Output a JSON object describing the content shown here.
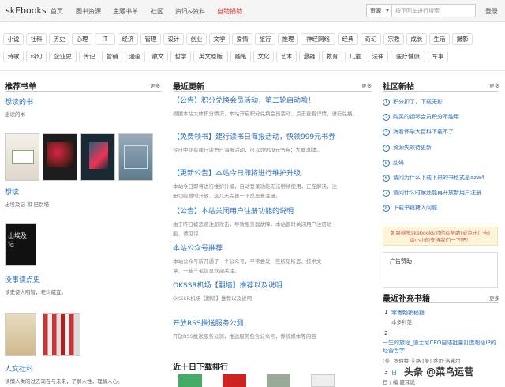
{
  "header": {
    "logo": "skEbooks",
    "nav": [
      "首页",
      "图书资源",
      "主题书单",
      "社区",
      "资讯&资料",
      "自助捐助"
    ],
    "search_scope": "资源",
    "search_placeholder": "按下回车进行搜索",
    "login": "登录"
  },
  "tags": [
    "小说",
    "社科",
    "历史",
    "心理",
    "IT",
    "经济",
    "管理",
    "设计",
    "创业",
    "文学",
    "爱情",
    "旅行",
    "推理",
    "神经网络",
    "经典",
    "奇幻",
    "宗教",
    "成长",
    "生活",
    "摄影",
    "诗歌",
    "科幻",
    "企业史",
    "传记",
    "营销",
    "漫画",
    "散文",
    "哲学",
    "英文原版",
    "随笔",
    "文化",
    "艺术",
    "悬疑",
    "教育",
    "儿童",
    "法律",
    "医疗健康",
    "军事"
  ],
  "left": {
    "heading": "推荐书单",
    "more": "更多",
    "lists": [
      {
        "title": "想读的书",
        "desc": "想读的书"
      },
      {
        "title": "想读",
        "desc": "出埃及记 和 巴别塔"
      },
      {
        "title": "没事读点史",
        "desc": "读史使人明智，老少咸宜。"
      },
      {
        "title": "人文社科",
        "desc": "读懂人类的过去现在与未来，了解人性，理解人心。"
      }
    ],
    "cover_text": "出埃及记"
  },
  "middle": {
    "heading": "最近更新",
    "more": "更多",
    "news": [
      {
        "title": "【公告】积分兑换会员活动，第二轮启动啦！",
        "desc": [
          "根据本站大体积分情况，本站开启积分兑换会员活动，点击查看详情，进行兑换。"
        ]
      },
      {
        "title": "【免费领书】建行读书日海报活动，快领999元书券",
        "desc": [
          "今日中亚有建行读书日海报活动，可以领999元书券；大概30本。"
        ]
      },
      {
        "title": "【更新公告】本站今日即将进行维护升级",
        "desc": [
          "本站今日即将进行维护升级，自动登录功能无法继续使用，正在解决，注",
          "册功能暂时开放，这几天完善一下反恶意注册。"
        ]
      },
      {
        "title": "【公告】本站关闭用户注册功能的说明",
        "desc": [
          "由于昨日被恶意注册攻击，导致服务器故障，本站暂时关闭用户注册功",
          "能，请见谅"
        ]
      },
      {
        "title": "本站公众号推荐",
        "desc": [
          "本站公众号新开通了一个公众号，平常会发一些所见所思、技术文",
          "章、一些羊毛信息欢迎关注。"
        ]
      },
      {
        "title": "OKSSR机场【翻墙】推荐以及说明",
        "desc": [
          "OKSSR机场【翻墙】推荐以及说明"
        ]
      },
      {
        "title": "开放RSS推送服务公测",
        "desc": [
          "开放RSS推送服务公测，推送服务包含公众号，传统媒体等内容"
        ]
      }
    ],
    "ranking_heading": "近十日下载排行"
  },
  "right": {
    "heading": "社区新帖",
    "more": "更多",
    "posts": [
      "积分扣了，下载无影",
      "购买的钢琴会员积分不能用",
      "海看怀孕大百科下载不了",
      "资源失效待更新",
      "乱码",
      "请问为什么下载下来的书格式是azw4",
      "请问什么时候还能再开放新用户注册",
      "下载书籍拷入问题"
    ],
    "ad_yellow": [
      "如果感觉skebooks对你有帮助(或点击广告)",
      "请小小的支持我们一下吧！"
    ],
    "ad_label": "广告赞助",
    "supp_heading": "最近补充书籍",
    "supp_more": "更多",
    "supp": [
      {
        "num": "1",
        "title": "零售畅销秘籍",
        "author": "本多利范"
      },
      {
        "num": "2",
        "title": "一生的旅程_迪士尼CEO自述批量打造超级IP的经营哲学",
        "author": "[美] 罗伯特·艾格 [美] 乔尔·洛弗尔"
      },
      {
        "num": "3",
        "title": "日",
        "author": "日 / 编 聂耳说"
      }
    ]
  },
  "watermark": "头条 @菜鸟运营",
  "colors": {
    "link": "#2a6fbd",
    "donate": "#e03a3a"
  }
}
